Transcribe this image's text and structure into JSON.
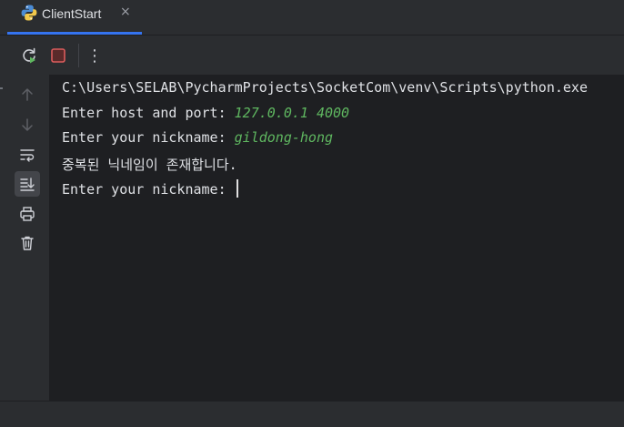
{
  "tab": {
    "label": "ClientStart",
    "close_glyph": "×",
    "icon": "python-icon"
  },
  "toolbar": {
    "rerun_icon": "rerun-icon",
    "stop_icon": "stop-icon",
    "more_icon": "more-vertical-icon",
    "more_glyph": "⋮"
  },
  "sidebar": {
    "items": [
      {
        "name": "scroll-up-icon"
      },
      {
        "name": "scroll-down-icon"
      },
      {
        "name": "soft-wrap-icon"
      },
      {
        "name": "scroll-to-end-icon",
        "active": true
      },
      {
        "name": "print-icon"
      },
      {
        "name": "clear-all-icon"
      }
    ]
  },
  "console": {
    "line1": "C:\\Users\\SELAB\\PycharmProjects\\SocketCom\\venv\\Scripts\\python.exe",
    "line2_prompt": "Enter host and port: ",
    "line2_input": "127.0.0.1 4000",
    "line3_prompt": "Enter your nickname: ",
    "line3_input": "gildong-hong",
    "line4": "중복된 닉네임이 존재합니다.",
    "line5_prompt": "Enter your nickname: "
  },
  "colors": {
    "accent": "#3574f0",
    "user_input": "#5fb760",
    "stop": "#db5c5c",
    "rerun_badge": "#5fb760"
  }
}
